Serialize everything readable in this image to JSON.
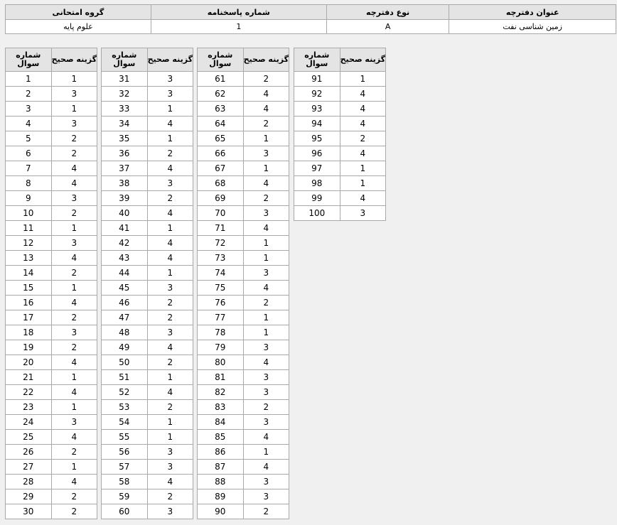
{
  "info": {
    "headers": [
      "عنوان دفترچه",
      "نوع دفترچه",
      "شماره پاسخنامه",
      "گروه امتحانی"
    ],
    "values": [
      "زمین شناسی نفت",
      "A",
      "1",
      "علوم پایه"
    ]
  },
  "key_headers": {
    "question": "شماره سوال",
    "answer": "گزینه صحیح"
  },
  "columns": [
    {
      "rows": [
        [
          "1",
          "1"
        ],
        [
          "2",
          "3"
        ],
        [
          "3",
          "1"
        ],
        [
          "4",
          "3"
        ],
        [
          "5",
          "2"
        ],
        [
          "6",
          "2"
        ],
        [
          "7",
          "4"
        ],
        [
          "8",
          "4"
        ],
        [
          "9",
          "3"
        ],
        [
          "10",
          "2"
        ],
        [
          "11",
          "1"
        ],
        [
          "12",
          "3"
        ],
        [
          "13",
          "4"
        ],
        [
          "14",
          "2"
        ],
        [
          "15",
          "1"
        ],
        [
          "16",
          "4"
        ],
        [
          "17",
          "2"
        ],
        [
          "18",
          "3"
        ],
        [
          "19",
          "2"
        ],
        [
          "20",
          "4"
        ],
        [
          "21",
          "1"
        ],
        [
          "22",
          "4"
        ],
        [
          "23",
          "1"
        ],
        [
          "24",
          "3"
        ],
        [
          "25",
          "4"
        ],
        [
          "26",
          "2"
        ],
        [
          "27",
          "1"
        ],
        [
          "28",
          "4"
        ],
        [
          "29",
          "2"
        ],
        [
          "30",
          "2"
        ]
      ]
    },
    {
      "rows": [
        [
          "31",
          "3"
        ],
        [
          "32",
          "3"
        ],
        [
          "33",
          "1"
        ],
        [
          "34",
          "4"
        ],
        [
          "35",
          "1"
        ],
        [
          "36",
          "2"
        ],
        [
          "37",
          "4"
        ],
        [
          "38",
          "3"
        ],
        [
          "39",
          "2"
        ],
        [
          "40",
          "4"
        ],
        [
          "41",
          "1"
        ],
        [
          "42",
          "4"
        ],
        [
          "43",
          "4"
        ],
        [
          "44",
          "1"
        ],
        [
          "45",
          "3"
        ],
        [
          "46",
          "2"
        ],
        [
          "47",
          "2"
        ],
        [
          "48",
          "3"
        ],
        [
          "49",
          "4"
        ],
        [
          "50",
          "2"
        ],
        [
          "51",
          "1"
        ],
        [
          "52",
          "4"
        ],
        [
          "53",
          "2"
        ],
        [
          "54",
          "1"
        ],
        [
          "55",
          "1"
        ],
        [
          "56",
          "3"
        ],
        [
          "57",
          "3"
        ],
        [
          "58",
          "4"
        ],
        [
          "59",
          "2"
        ],
        [
          "60",
          "3"
        ]
      ]
    },
    {
      "rows": [
        [
          "61",
          "2"
        ],
        [
          "62",
          "4"
        ],
        [
          "63",
          "4"
        ],
        [
          "64",
          "2"
        ],
        [
          "65",
          "1"
        ],
        [
          "66",
          "3"
        ],
        [
          "67",
          "1"
        ],
        [
          "68",
          "4"
        ],
        [
          "69",
          "2"
        ],
        [
          "70",
          "3"
        ],
        [
          "71",
          "4"
        ],
        [
          "72",
          "1"
        ],
        [
          "73",
          "1"
        ],
        [
          "74",
          "3"
        ],
        [
          "75",
          "4"
        ],
        [
          "76",
          "2"
        ],
        [
          "77",
          "1"
        ],
        [
          "78",
          "1"
        ],
        [
          "79",
          "3"
        ],
        [
          "80",
          "4"
        ],
        [
          "81",
          "3"
        ],
        [
          "82",
          "3"
        ],
        [
          "83",
          "2"
        ],
        [
          "84",
          "3"
        ],
        [
          "85",
          "4"
        ],
        [
          "86",
          "1"
        ],
        [
          "87",
          "4"
        ],
        [
          "88",
          "3"
        ],
        [
          "89",
          "3"
        ],
        [
          "90",
          "2"
        ]
      ]
    },
    {
      "rows": [
        [
          "91",
          "1"
        ],
        [
          "92",
          "4"
        ],
        [
          "93",
          "4"
        ],
        [
          "94",
          "4"
        ],
        [
          "95",
          "2"
        ],
        [
          "96",
          "4"
        ],
        [
          "97",
          "1"
        ],
        [
          "98",
          "1"
        ],
        [
          "99",
          "4"
        ],
        [
          "100",
          "3"
        ]
      ]
    }
  ]
}
